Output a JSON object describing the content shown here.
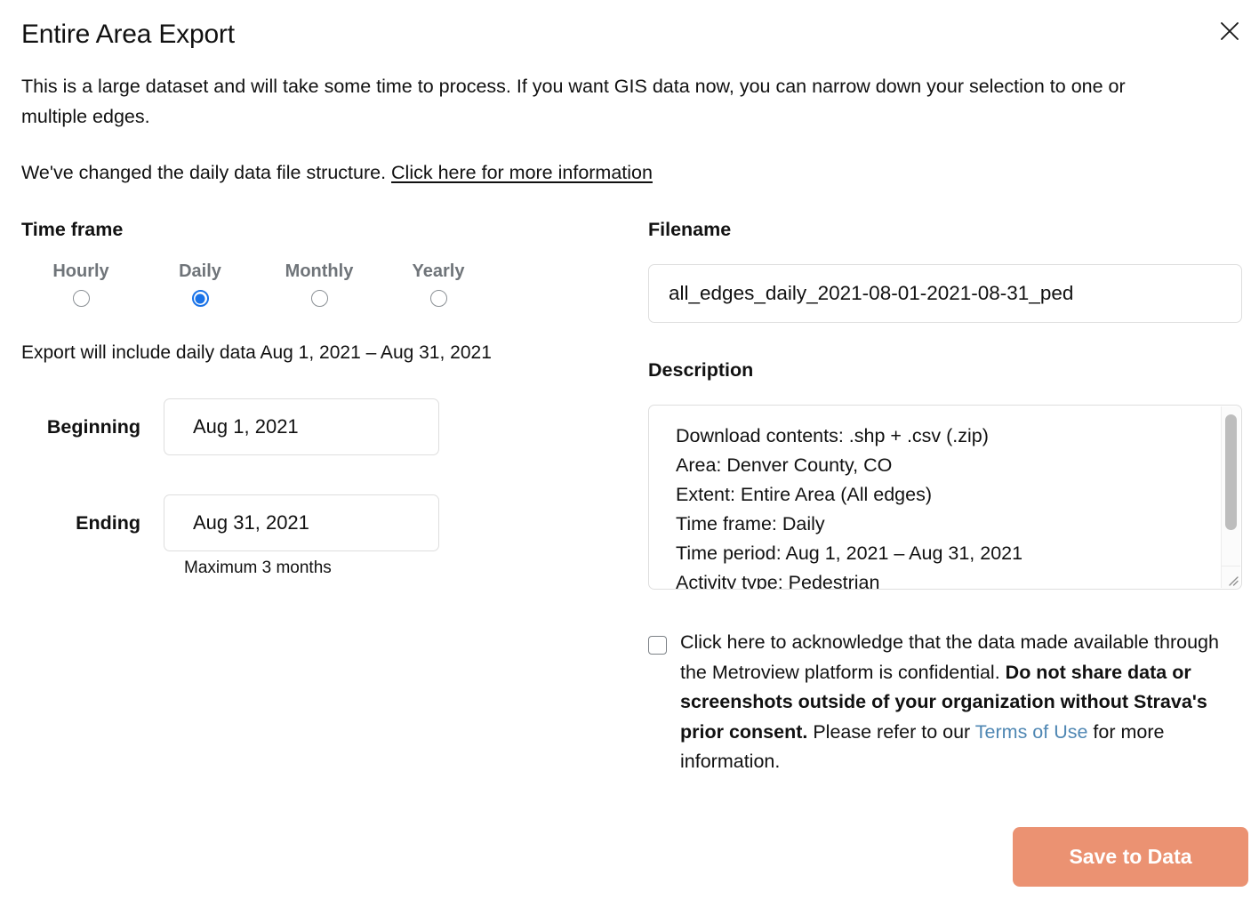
{
  "dialog": {
    "title": "Entire Area Export",
    "close_icon": "close-icon",
    "intro": "This is a large dataset and will take some time to process. If you want GIS data now, you can narrow down your selection to one or multiple edges.",
    "note_prefix": "We've changed the daily data file structure. ",
    "note_link": "Click here for more information"
  },
  "timeframe": {
    "label": "Time frame",
    "options": [
      {
        "label": "Hourly",
        "selected": false
      },
      {
        "label": "Daily",
        "selected": true
      },
      {
        "label": "Monthly",
        "selected": false
      },
      {
        "label": "Yearly",
        "selected": false
      }
    ],
    "export_note": "Export will include daily data Aug 1, 2021 – Aug 31, 2021",
    "beginning_label": "Beginning",
    "beginning_value": "Aug 1, 2021",
    "ending_label": "Ending",
    "ending_value": "Aug 31, 2021",
    "max_note": "Maximum 3 months"
  },
  "filename": {
    "label": "Filename",
    "value": "all_edges_daily_2021-08-01-2021-08-31_ped"
  },
  "description": {
    "label": "Description",
    "value": "Download contents: .shp + .csv (.zip)\nArea: Denver County, CO\nExtent: Entire Area (All edges)\nTime frame: Daily\nTime period: Aug 1, 2021 – Aug 31, 2021\nActivity type: Pedestrian",
    "lines": [
      "Download contents: .shp + .csv (.zip)",
      "Area: Denver County, CO",
      "Extent: Entire Area (All edges)",
      "Time frame: Daily",
      "Time period: Aug 1, 2021 – Aug 31, 2021",
      "Activity type: Pedestrian"
    ]
  },
  "acknowledgement": {
    "checked": false,
    "part1": "Click here to acknowledge that the data made available through the Metroview platform is confidential. ",
    "bold": "Do not share data or screenshots outside of your organization without Strava's prior consent.",
    "part2": " Please refer to our ",
    "link": "Terms of Use",
    "part3": " for more information."
  },
  "footer": {
    "save_label": "Save to Data"
  },
  "colors": {
    "radio_selected": "#1a73e8",
    "save_button": "#eb9272",
    "link": "#4f87b3",
    "muted_label": "#6f7479",
    "border": "#dedede"
  }
}
